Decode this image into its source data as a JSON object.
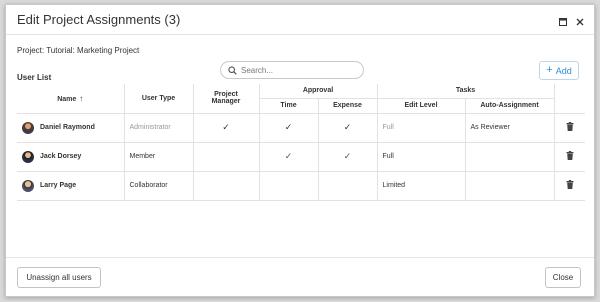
{
  "dialog": {
    "title": "Edit Project Assignments (3)",
    "project_label": "Project: Tutorial: Marketing Project",
    "user_list_label": "User List",
    "search_placeholder": "Search...",
    "add_label": "Add"
  },
  "table": {
    "headers": {
      "name": "Name",
      "sort_indicator": "↑",
      "user_type": "User Type",
      "project_manager_line1": "Project",
      "project_manager_line2": "Manager",
      "approval": "Approval",
      "time": "Time",
      "expense": "Expense",
      "tasks": "Tasks",
      "edit_level": "Edit Level",
      "auto_assignment": "Auto-Assignment"
    },
    "rows": [
      {
        "name": "Daniel Raymond",
        "user_type": "Administrator",
        "project_manager": "✓",
        "time": "✓",
        "expense": "✓",
        "edit_level": "Full",
        "auto_assignment": "As Reviewer"
      },
      {
        "name": "Jack Dorsey",
        "user_type": "Member",
        "project_manager": "",
        "time": "✓",
        "expense": "✓",
        "edit_level": "Full",
        "auto_assignment": ""
      },
      {
        "name": "Larry Page",
        "user_type": "Collaborator",
        "project_manager": "",
        "time": "",
        "expense": "",
        "edit_level": "Limited",
        "auto_assignment": ""
      }
    ]
  },
  "footer": {
    "unassign_label": "Unassign all users",
    "close_label": "Close"
  },
  "colors": {
    "accent": "#2d8fd8",
    "border": "#e2e2e2"
  },
  "icons": [
    "maximize-icon",
    "close-icon",
    "search-icon",
    "plus-icon",
    "trash-icon"
  ]
}
